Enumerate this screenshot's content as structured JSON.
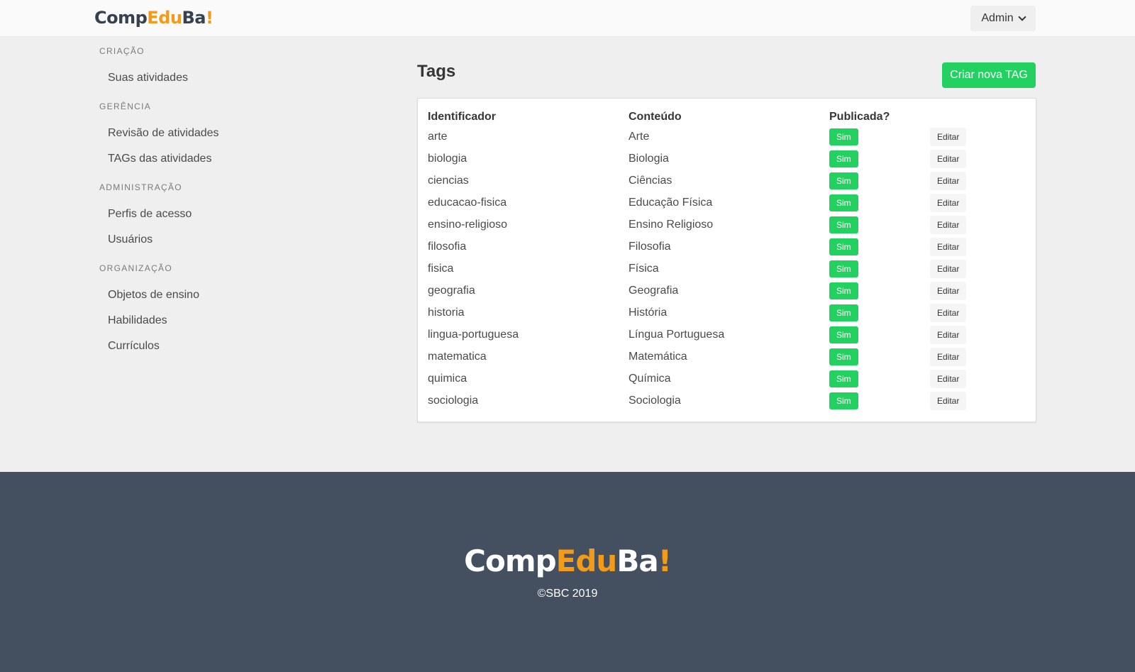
{
  "header": {
    "logo": {
      "part1": "Comp",
      "part2": "Edu",
      "part3": "Ba",
      "part4": "!"
    },
    "user_menu_label": "Admin"
  },
  "sidebar": {
    "sections": [
      {
        "label": "CRIAÇÃO",
        "items": [
          "Suas atividades"
        ]
      },
      {
        "label": "GERÊNCIA",
        "items": [
          "Revisão de atividades",
          "TAGs das atividades"
        ]
      },
      {
        "label": "ADMINISTRAÇÃO",
        "items": [
          "Perfis de acesso",
          "Usuários"
        ]
      },
      {
        "label": "ORGANIZAÇÃO",
        "items": [
          "Objetos de ensino",
          "Habilidades",
          "Currículos"
        ]
      }
    ]
  },
  "main": {
    "title": "Tags",
    "create_button": "Criar nova TAG",
    "table": {
      "headers": [
        "Identificador",
        "Conteúdo",
        "Publicada?",
        ""
      ],
      "edit_label": "Editar",
      "rows": [
        {
          "id": "arte",
          "content": "Arte",
          "published": "Sim"
        },
        {
          "id": "biologia",
          "content": "Biologia",
          "published": "Sim"
        },
        {
          "id": "ciencias",
          "content": "Ciências",
          "published": "Sim"
        },
        {
          "id": "educacao-fisica",
          "content": "Educação Física",
          "published": "Sim"
        },
        {
          "id": "ensino-religioso",
          "content": "Ensino Religioso",
          "published": "Sim"
        },
        {
          "id": "filosofia",
          "content": "Filosofia",
          "published": "Sim"
        },
        {
          "id": "fisica",
          "content": "Física",
          "published": "Sim"
        },
        {
          "id": "geografia",
          "content": "Geografia",
          "published": "Sim"
        },
        {
          "id": "historia",
          "content": "História",
          "published": "Sim"
        },
        {
          "id": "lingua-portuguesa",
          "content": "Língua Portuguesa",
          "published": "Sim"
        },
        {
          "id": "matematica",
          "content": "Matemática",
          "published": "Sim"
        },
        {
          "id": "quimica",
          "content": "Química",
          "published": "Sim"
        },
        {
          "id": "sociologia",
          "content": "Sociologia",
          "published": "Sim"
        }
      ]
    }
  },
  "footer": {
    "logo": {
      "part1": "Comp",
      "part2": "Edu",
      "part3": "Ba",
      "part4": "!"
    },
    "copyright": "©SBC 2019"
  },
  "colors": {
    "accent_green": "#23d160",
    "logo_orange": "#f29a1a",
    "footer_bg": "#445060"
  }
}
